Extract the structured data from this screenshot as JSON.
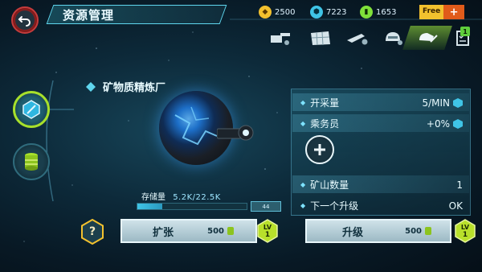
{
  "header": {
    "title": "资源管理",
    "resources": [
      {
        "name": "gold",
        "value": "2500",
        "icon": "gold-coin-icon",
        "color": "#f2c12e"
      },
      {
        "name": "crystal",
        "value": "7223",
        "icon": "crystal-icon",
        "color": "#3fc4e6"
      },
      {
        "name": "energy",
        "value": "1653",
        "icon": "energy-cell-icon",
        "color": "#7fe03a"
      }
    ],
    "free_label": "Free",
    "free_plus": "+",
    "toolbar_badge": "1"
  },
  "facility": {
    "name": "矿物质精炼厂"
  },
  "storage": {
    "label": "存储量",
    "value": "5.2K/22.5K",
    "fill_fraction": 0.23,
    "cap_label": "44"
  },
  "expand_button": {
    "label": "扩张",
    "cost": "500",
    "level": "1",
    "level_prefix": "LV"
  },
  "info_panel": {
    "mining_rate_label": "开采量",
    "mining_rate_value": "5/MIN",
    "crew_label": "乘务员",
    "crew_value": "+0%",
    "mine_count_label": "矿山数量",
    "mine_count_value": "1",
    "next_upgrade_label": "下一个升级",
    "next_upgrade_value": "OK"
  },
  "upgrade_button": {
    "label": "升级",
    "cost": "500",
    "level": "1",
    "level_prefix": "LV"
  },
  "help_label": "?",
  "colors": {
    "accent_green": "#a7e02b",
    "accent_cyan": "#5fd6ee",
    "warning_red": "#c43c3c"
  }
}
